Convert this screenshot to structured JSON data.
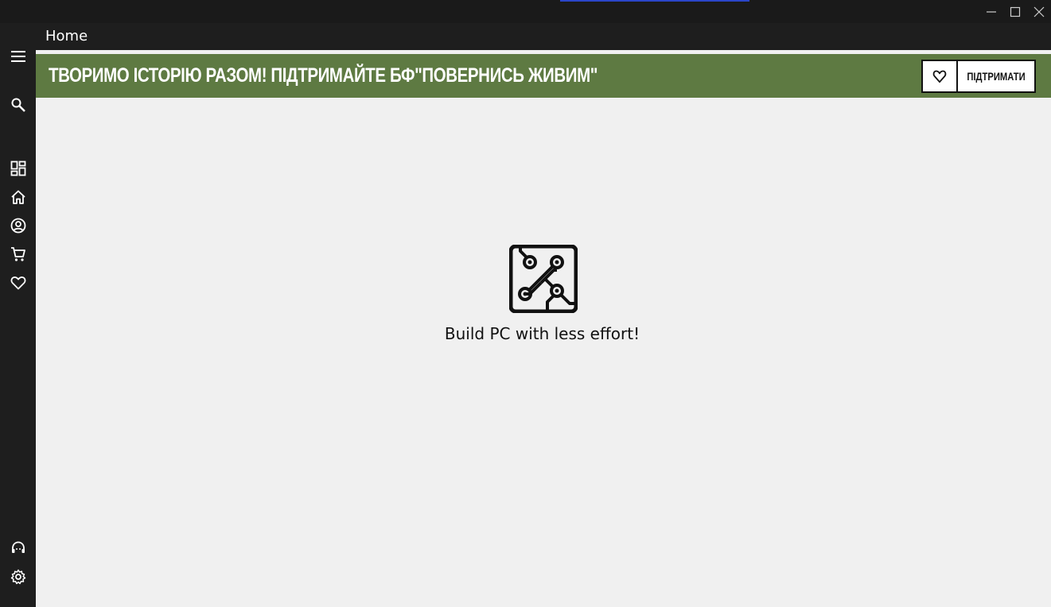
{
  "window": {
    "controls": [
      "minimize-icon",
      "maximize-icon",
      "close-icon"
    ]
  },
  "sidebar": {
    "top_icons": [
      "menu-icon",
      "search-icon"
    ],
    "nav_icons": [
      "dashboard-icon",
      "home-icon",
      "account-icon",
      "cart-icon",
      "favorites-icon"
    ],
    "bottom_icons": [
      "support-icon",
      "settings-icon"
    ]
  },
  "header": {
    "title": "Home"
  },
  "banner": {
    "text": "ТВОРИМО ІСТОРІЮ РАЗОМ! ПІДТРИМАЙТЕ БФ\"ПОВЕРНИСЬ ЖИВИМ\"",
    "button_label": "ПІДТРИМАТИ",
    "background": "#5e7a42"
  },
  "main": {
    "logo_icon": "circuit-board-icon",
    "tagline": "Build PC with less effort!"
  },
  "colors": {
    "sidebar_bg": "#1e1e1e",
    "content_bg": "#f0f0f0",
    "accent": "#2b45c9"
  }
}
